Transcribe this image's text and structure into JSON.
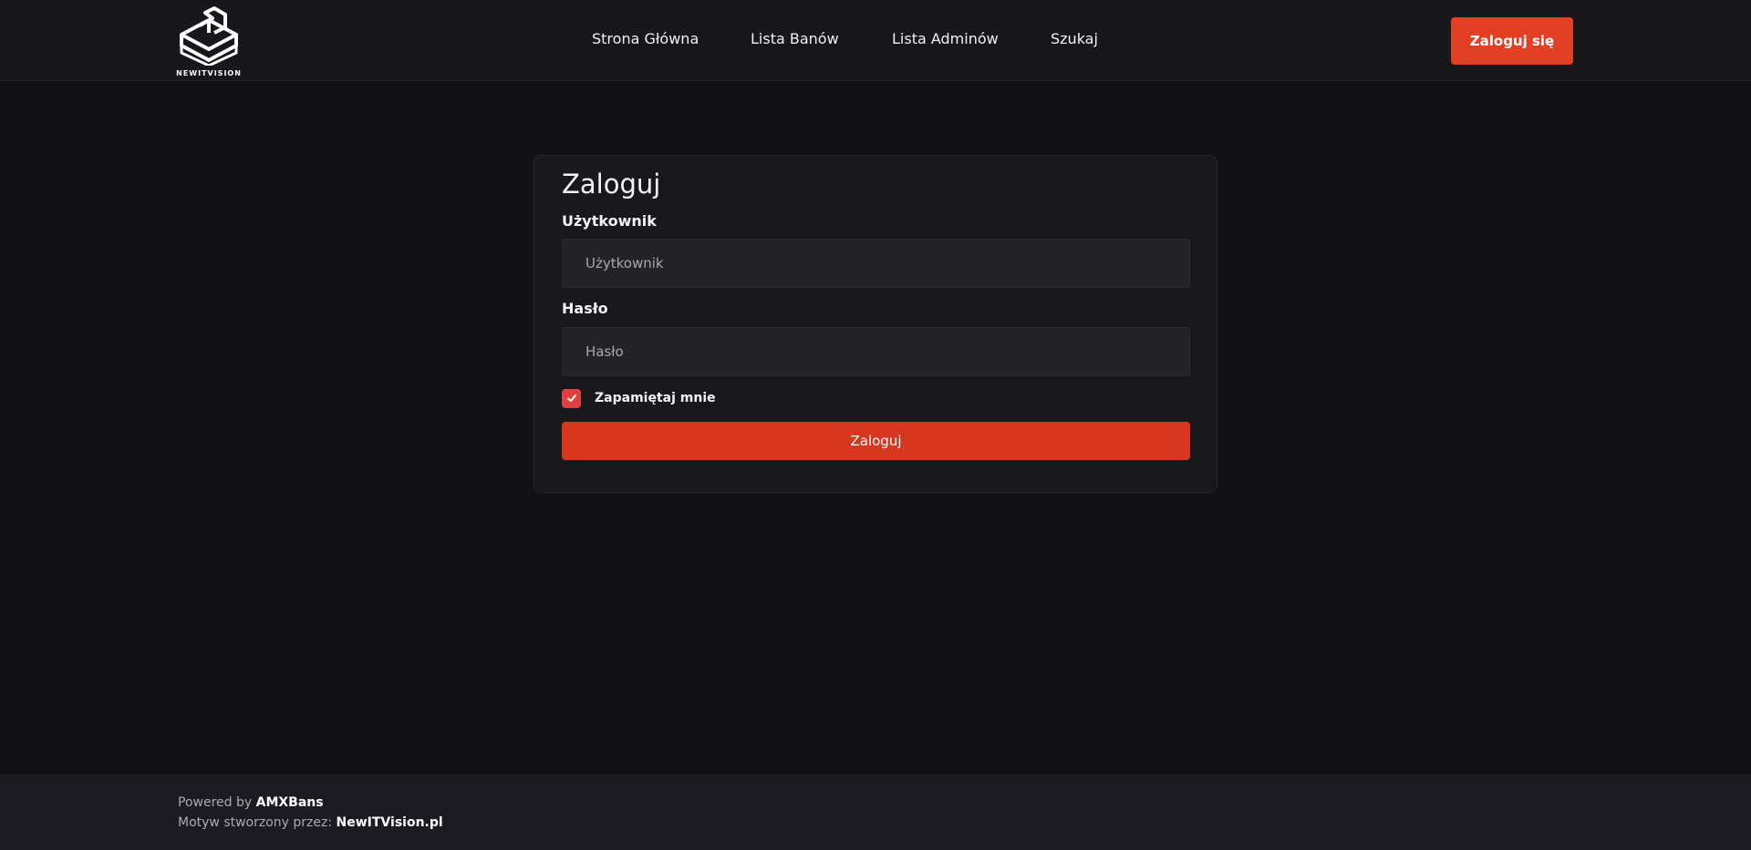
{
  "header": {
    "logo_text": "NEWITVISION",
    "nav": [
      {
        "label": "Strona Główna"
      },
      {
        "label": "Lista Banów"
      },
      {
        "label": "Lista Adminów"
      },
      {
        "label": "Szukaj"
      }
    ],
    "login_button": "Zaloguj się"
  },
  "login_form": {
    "title": "Zaloguj",
    "username_label": "Użytkownik",
    "username_placeholder": "Użytkownik",
    "username_value": "",
    "password_label": "Hasło",
    "password_placeholder": "Hasło",
    "password_value": "",
    "remember_label": "Zapamiętaj mnie",
    "remember_checked": true,
    "submit_label": "Zaloguj"
  },
  "footer": {
    "powered_prefix": "Powered by",
    "powered_name": "AMXBans",
    "theme_prefix": "Motyw stworzony przez:",
    "theme_name": "NewITVision.pl"
  },
  "colors": {
    "accent": "#e23f25",
    "background": "#111116",
    "header_bg": "#17171c",
    "card_bg": "#18181d",
    "input_bg": "#222227"
  },
  "icons": {
    "logo": "newitvision-cube-logo-icon",
    "checkbox": "check-icon"
  }
}
